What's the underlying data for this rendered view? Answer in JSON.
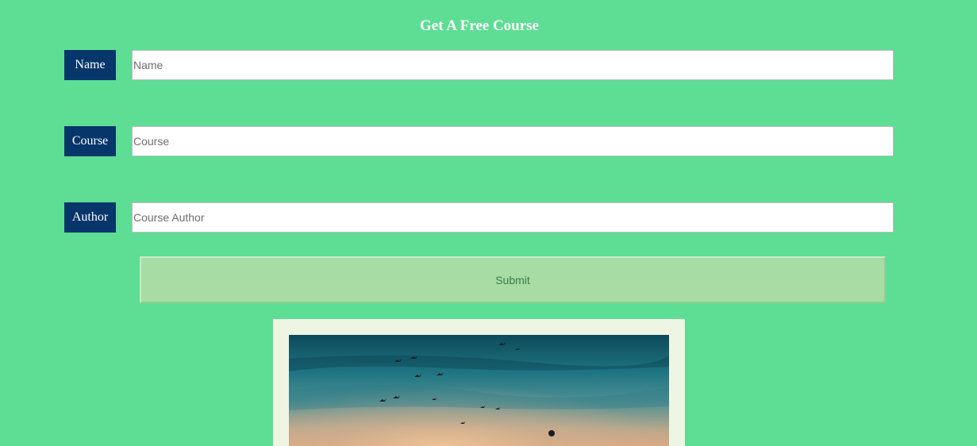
{
  "form": {
    "title": "Get A Free Course",
    "fields": [
      {
        "label": "Name",
        "placeholder": "Name",
        "value": ""
      },
      {
        "label": "Course",
        "placeholder": "Course",
        "value": ""
      },
      {
        "label": "Author",
        "placeholder": "Course Author",
        "value": ""
      }
    ],
    "submit_label": "Submit"
  },
  "colors": {
    "background": "#5edd95",
    "label_background": "#06366a",
    "submit_background": "#a8dca5",
    "frame_background": "#eef5e2"
  },
  "image": {
    "subject": "sunset sky with flying birds"
  }
}
